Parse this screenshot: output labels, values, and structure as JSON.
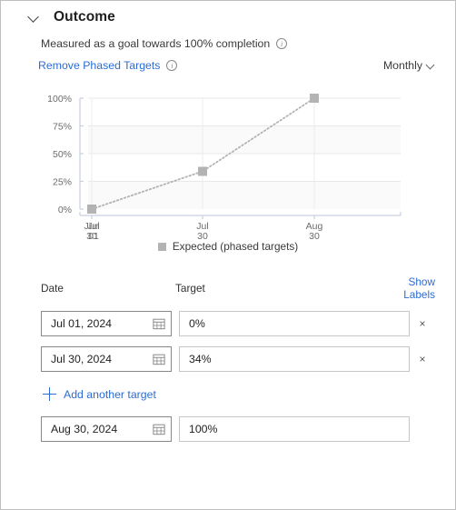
{
  "header": {
    "title": "Outcome",
    "collapse_icon": "chevron-down-icon"
  },
  "subtitle": {
    "text": "Measured as a goal towards 100% completion",
    "info_icon": "info-icon"
  },
  "controls": {
    "remove_phased_targets": "Remove Phased Targets",
    "remove_info_icon": "info-icon",
    "frequency": "Monthly",
    "frequency_caret": "chevron-down-icon"
  },
  "chart_data": {
    "type": "line",
    "title": "",
    "xlabel": "",
    "ylabel": "",
    "ylim": [
      0,
      100
    ],
    "yticks": [
      "0%",
      "25%",
      "50%",
      "75%",
      "100%"
    ],
    "ytick_values": [
      0,
      25,
      50,
      75,
      100
    ],
    "categories": [
      "Jun 30 / Jul 01",
      "Jul 30",
      "Aug 30"
    ],
    "xtick_labels": [
      {
        "line1": "Jun",
        "line2": "30",
        "overlap_line1": "Jul",
        "overlap_line2": "01"
      },
      {
        "line1": "Jul",
        "line2": "30"
      },
      {
        "line1": "Aug",
        "line2": "30"
      }
    ],
    "series": [
      {
        "name": "Expected (phased targets)",
        "values": [
          0,
          34,
          100
        ],
        "color": "#b3b3b3",
        "style": "dotted",
        "marker": "square"
      }
    ],
    "legend": [
      {
        "label": "Expected (phased targets)",
        "color": "#b3b3b3"
      }
    ],
    "legend_position": "bottom",
    "grid": true
  },
  "table": {
    "columns": {
      "date": "Date",
      "target": "Target"
    },
    "show_labels": "Show Labels",
    "rows": [
      {
        "date": "Jul 01, 2024",
        "target": "0%",
        "removable": true
      },
      {
        "date": "Jul 30, 2024",
        "target": "34%",
        "removable": true
      },
      {
        "date": "Aug 30, 2024",
        "target": "100%",
        "removable": false
      }
    ],
    "remove_label": "×",
    "add_target": "Add another target",
    "calendar_icon": "calendar-icon",
    "plus_icon": "plus-icon",
    "remove_icon": "close-icon"
  },
  "colors": {
    "link": "#2b6cd4",
    "series": "#b3b3b3",
    "axis": "#c8cfe0",
    "text": "#323130"
  }
}
